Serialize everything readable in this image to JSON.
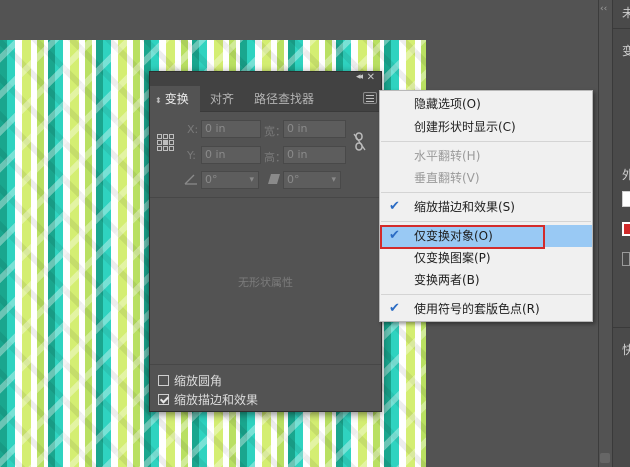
{
  "dock": {
    "labels": [
      "未",
      "变",
      "外",
      "快"
    ],
    "collapse_icon": "collapse-arrows-icon"
  },
  "transform_panel": {
    "collapse_icon": "◂◂",
    "close_icon": "✕",
    "tab_arrow": "⬍",
    "tabs": [
      "变换",
      "对齐",
      "路径查找器"
    ],
    "fields": {
      "x_label": "X:",
      "x_value": "0 in",
      "y_label": "Y:",
      "y_value": "0 in",
      "w_label": "宽：",
      "w_value": "0 in",
      "h_label": "高：",
      "h_value": "0 in",
      "rotate_value": "0°",
      "shear_value": "0°"
    },
    "no_shape_text": "无形状属性",
    "checkboxes": [
      {
        "label": "缩放圆角",
        "checked": false
      },
      {
        "label": "缩放描边和效果",
        "checked": true
      }
    ]
  },
  "flyout_menu": {
    "check_glyph": "✔",
    "items": [
      {
        "label": "隐藏选项(O)",
        "checked": false,
        "disabled": false
      },
      {
        "label": "创建形状时显示(C)",
        "checked": false,
        "disabled": false
      },
      {
        "label": "水平翻转(H)",
        "checked": false,
        "disabled": true
      },
      {
        "label": "垂直翻转(V)",
        "checked": false,
        "disabled": true
      },
      {
        "label": "缩放描边和效果(S)",
        "checked": true,
        "disabled": false
      },
      {
        "label": "仅变换对象(O)",
        "checked": true,
        "disabled": false,
        "highlighted": true
      },
      {
        "label": "仅变换图案(P)",
        "checked": false,
        "disabled": false
      },
      {
        "label": "变换两者(B)",
        "checked": false,
        "disabled": false
      },
      {
        "label": "使用符号的套版色点(R)",
        "checked": true,
        "disabled": false
      }
    ]
  },
  "colors": {
    "highlight": "#99c9f4",
    "annotation_box": "#d32b2b",
    "pattern_teal": "#1aa68e",
    "pattern_cyan": "#2fd3c0",
    "pattern_lime": "#d4ee72"
  }
}
